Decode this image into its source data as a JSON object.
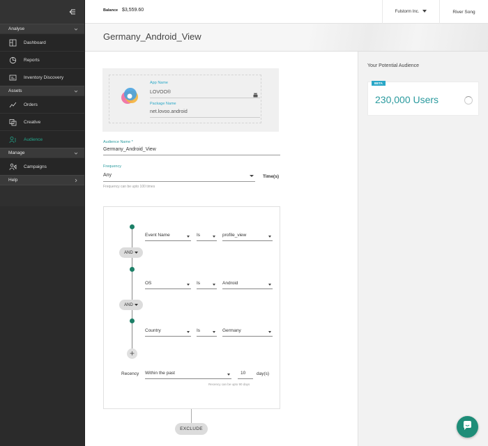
{
  "sidebar": {
    "sections": [
      {
        "label": "Analyse",
        "items": [
          "Dashboard",
          "Reports",
          "Inventory Discovery"
        ]
      },
      {
        "label": "Assets",
        "items": [
          "Orders",
          "Creative",
          "Audience"
        ]
      },
      {
        "label": "Manage",
        "items": [
          "Campaigns"
        ]
      },
      {
        "label": "Help",
        "items": []
      }
    ],
    "active_item": "Audience",
    "accent_color": "#23a88c"
  },
  "topbar": {
    "balance_label": "Balance",
    "balance_value": "$3,559.60",
    "org": "Fulstorm Inc.",
    "user": "River Song"
  },
  "page": {
    "title": "Germany_Android_View"
  },
  "app_card": {
    "app_name_label": "App Name",
    "app_name": "LOVOO®",
    "package_label": "Package Name",
    "package_name": "net.lovoo.android",
    "platform_icon": "android-icon"
  },
  "form": {
    "audience_label": "Audience Name *",
    "audience_value": "Germany_Android_View",
    "frequency_label": "Frequency",
    "frequency_value": "Any",
    "frequency_hint": "Frequency can be upto 100 times",
    "times_label": "Time(s)"
  },
  "rules": {
    "conditions": [
      {
        "field": "Event Name",
        "op": "Is",
        "value": "profile_view"
      },
      {
        "field": "OS",
        "op": "Is",
        "value": "Android"
      },
      {
        "field": "Country",
        "op": "Is",
        "value": "Germany"
      }
    ],
    "joiner": "AND",
    "add_symbol": "+",
    "recency_label": "Recency",
    "recency_value": "Within the past",
    "recency_number": "10",
    "recency_unit": "day(s)",
    "recency_hint": "Recency can be upto 90 days",
    "exclude_label": "EXCLUDE"
  },
  "right_panel": {
    "title": "Your Potential Audience",
    "badge": "BETA",
    "audience_size": "230,000 Users"
  }
}
